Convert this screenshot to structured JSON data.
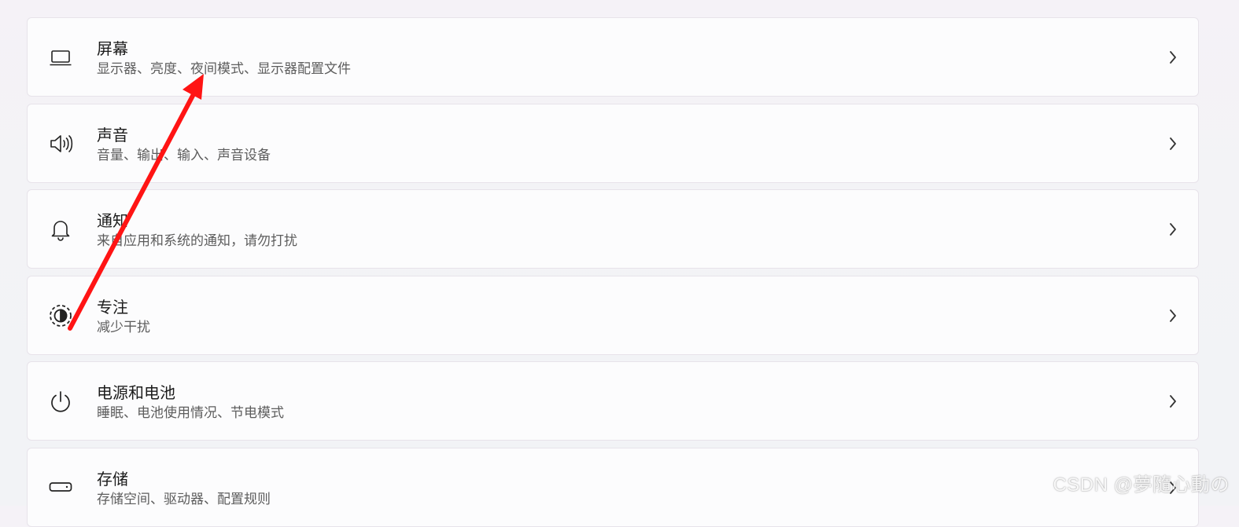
{
  "items": [
    {
      "title": "屏幕",
      "description": "显示器、亮度、夜间模式、显示器配置文件",
      "icon": "laptop-icon"
    },
    {
      "title": "声音",
      "description": "音量、输出、输入、声音设备",
      "icon": "speaker-icon"
    },
    {
      "title": "通知",
      "description": "来自应用和系统的通知，请勿打扰",
      "icon": "bell-icon"
    },
    {
      "title": "专注",
      "description": "减少干扰",
      "icon": "focus-icon"
    },
    {
      "title": "电源和电池",
      "description": "睡眠、电池使用情况、节电模式",
      "icon": "power-icon"
    },
    {
      "title": "存储",
      "description": "存储空间、驱动器、配置规则",
      "icon": "storage-drive-icon"
    }
  ],
  "chevron_icon": "chevron-right-icon",
  "watermark": "CSDN @夢隨心動の",
  "annotation": {
    "type": "arrow",
    "color": "#ff1414"
  }
}
